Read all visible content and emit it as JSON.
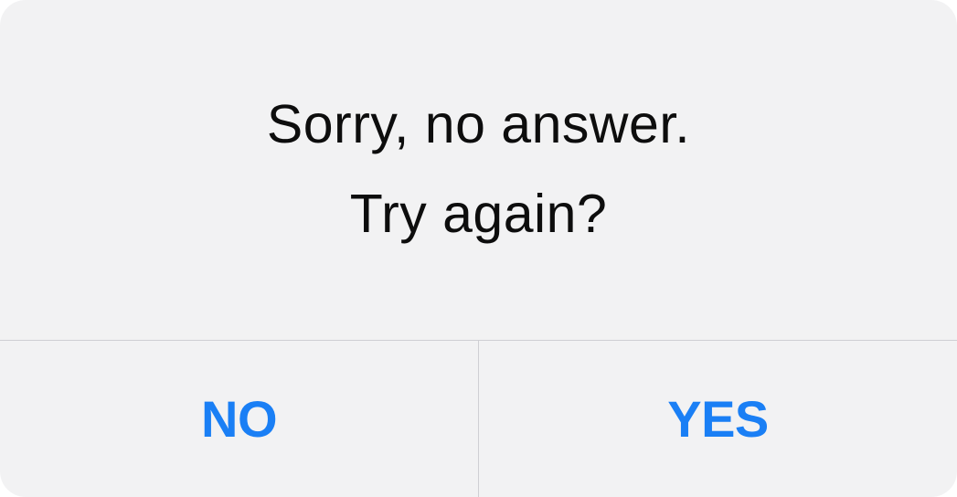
{
  "alert": {
    "message_lines": [
      "Sorry, no answer.",
      "Try again?"
    ],
    "buttons": {
      "no_label": "NO",
      "yes_label": "YES"
    }
  },
  "colors": {
    "accent": "#1a7ff5",
    "background": "#f2f2f3",
    "separator": "#cfcfd3",
    "text": "#0d0d0d"
  }
}
